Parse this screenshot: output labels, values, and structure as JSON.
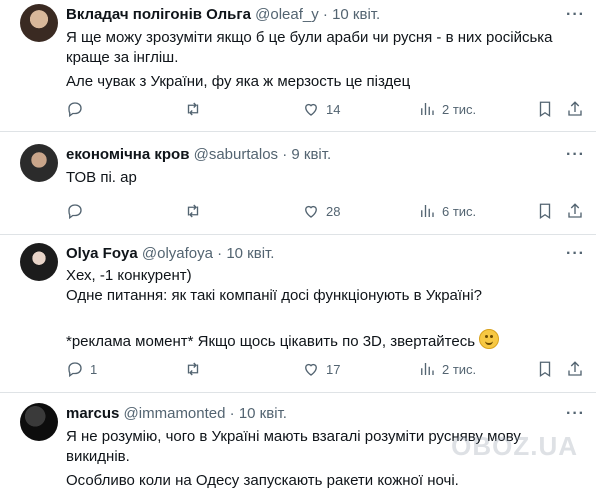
{
  "tweets": [
    {
      "name": "Вкладач полігонів Ольга",
      "handle": "@oleaf_y",
      "dot": "·",
      "date": "10 квіт.",
      "lines": [
        "Я ще можу зрозуміти якщо б це були араби чи русня - в них російська",
        "краще за інгліш.",
        "Але чувак з України, фу яка ж мерзость це піздец"
      ],
      "replies": "",
      "retweets": "",
      "likes": "14",
      "views": "2 тис."
    },
    {
      "name": "економічна кров",
      "handle": "@saburtalos",
      "dot": "·",
      "date": "9 квіт.",
      "lines": [
        "ТОВ пі. ар"
      ],
      "replies": "",
      "retweets": "",
      "likes": "28",
      "views": "6 тис."
    },
    {
      "name": "Olya Foya",
      "handle": "@olyafoya",
      "dot": "·",
      "date": "10 квіт.",
      "lines": [
        "Хех, -1 конкурент)",
        "Одне питання: як такі компанії досі функціонують в Україні?",
        "",
        "*реклама момент* Якщо щось цікавить по 3D, звертайтесь"
      ],
      "replies": "1",
      "retweets": "",
      "likes": "17",
      "views": "2 тис."
    },
    {
      "name": "marcus",
      "handle": "@immamonted",
      "dot": "·",
      "date": "10 квіт.",
      "lines": [
        "Я не розумію, чого в Україні мають взагалі розуміти русняву мову",
        "викиднів.",
        "Особливо коли на Одесу запускають ракети кожної ночі."
      ]
    }
  ],
  "watermark": "OBOZ.UA",
  "icons": [
    "more-icon",
    "reply-icon",
    "retweet-icon",
    "like-icon",
    "views-icon",
    "bookmark-icon",
    "share-icon",
    "smile-emoji"
  ]
}
